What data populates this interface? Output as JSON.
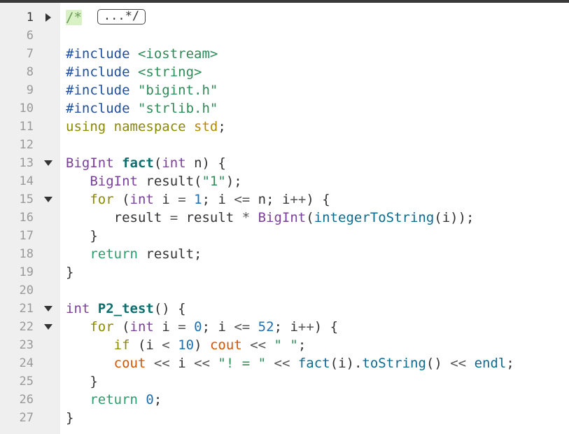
{
  "editor": {
    "lines": [
      {
        "num": "1",
        "fold": "right",
        "tokens": [
          {
            "t": "/*",
            "c": "comment-open"
          },
          {
            "t": "...*/",
            "c": "fold-box"
          }
        ]
      },
      {
        "num": "6",
        "fold": "",
        "tokens": []
      },
      {
        "num": "7",
        "fold": "",
        "tokens": [
          {
            "t": "#include ",
            "c": "pre"
          },
          {
            "t": "<iostream>",
            "c": "inc"
          }
        ]
      },
      {
        "num": "8",
        "fold": "",
        "tokens": [
          {
            "t": "#include ",
            "c": "pre"
          },
          {
            "t": "<string>",
            "c": "inc"
          }
        ]
      },
      {
        "num": "9",
        "fold": "",
        "tokens": [
          {
            "t": "#include ",
            "c": "pre"
          },
          {
            "t": "\"bigint.h\"",
            "c": "str"
          }
        ]
      },
      {
        "num": "10",
        "fold": "",
        "tokens": [
          {
            "t": "#include ",
            "c": "pre"
          },
          {
            "t": "\"strlib.h\"",
            "c": "str"
          }
        ]
      },
      {
        "num": "11",
        "fold": "",
        "tokens": [
          {
            "t": "using namespace",
            "c": "kw"
          },
          {
            "t": " ",
            "c": ""
          },
          {
            "t": "std",
            "c": "kw2"
          },
          {
            "t": ";",
            "c": ""
          }
        ]
      },
      {
        "num": "12",
        "fold": "",
        "tokens": []
      },
      {
        "num": "13",
        "fold": "down",
        "tokens": [
          {
            "t": "BigInt",
            "c": "cls"
          },
          {
            "t": " ",
            "c": ""
          },
          {
            "t": "fact",
            "c": "fn"
          },
          {
            "t": "(",
            "c": ""
          },
          {
            "t": "int",
            "c": "kw-type"
          },
          {
            "t": " n) {",
            "c": ""
          }
        ]
      },
      {
        "num": "14",
        "fold": "",
        "tokens": [
          {
            "t": "   ",
            "c": ""
          },
          {
            "t": "BigInt",
            "c": "cls"
          },
          {
            "t": " result(",
            "c": ""
          },
          {
            "t": "\"1\"",
            "c": "str"
          },
          {
            "t": ");",
            "c": ""
          }
        ]
      },
      {
        "num": "15",
        "fold": "down",
        "tokens": [
          {
            "t": "   ",
            "c": ""
          },
          {
            "t": "for",
            "c": "kw"
          },
          {
            "t": " (",
            "c": ""
          },
          {
            "t": "int",
            "c": "kw-type"
          },
          {
            "t": " i ",
            "c": ""
          },
          {
            "t": "=",
            "c": "op"
          },
          {
            "t": " ",
            "c": ""
          },
          {
            "t": "1",
            "c": "num"
          },
          {
            "t": "; i ",
            "c": ""
          },
          {
            "t": "<=",
            "c": "op"
          },
          {
            "t": " n; i",
            "c": ""
          },
          {
            "t": "++",
            "c": "op"
          },
          {
            "t": ") {",
            "c": ""
          }
        ]
      },
      {
        "num": "16",
        "fold": "",
        "tokens": [
          {
            "t": "      result ",
            "c": ""
          },
          {
            "t": "=",
            "c": "op"
          },
          {
            "t": " result ",
            "c": ""
          },
          {
            "t": "*",
            "c": "op"
          },
          {
            "t": " ",
            "c": ""
          },
          {
            "t": "BigInt",
            "c": "cls"
          },
          {
            "t": "(",
            "c": ""
          },
          {
            "t": "integerToString",
            "c": "call"
          },
          {
            "t": "(i));",
            "c": ""
          }
        ]
      },
      {
        "num": "17",
        "fold": "",
        "tokens": [
          {
            "t": "   }",
            "c": ""
          }
        ]
      },
      {
        "num": "18",
        "fold": "",
        "tokens": [
          {
            "t": "   ",
            "c": ""
          },
          {
            "t": "return",
            "c": "ret"
          },
          {
            "t": " result;",
            "c": ""
          }
        ]
      },
      {
        "num": "19",
        "fold": "",
        "tokens": [
          {
            "t": "}",
            "c": ""
          }
        ]
      },
      {
        "num": "20",
        "fold": "",
        "tokens": []
      },
      {
        "num": "21",
        "fold": "down",
        "tokens": [
          {
            "t": "int",
            "c": "kw-type"
          },
          {
            "t": " ",
            "c": ""
          },
          {
            "t": "P2_test",
            "c": "fn"
          },
          {
            "t": "() {",
            "c": ""
          }
        ]
      },
      {
        "num": "22",
        "fold": "down",
        "tokens": [
          {
            "t": "   ",
            "c": ""
          },
          {
            "t": "for",
            "c": "kw"
          },
          {
            "t": " (",
            "c": ""
          },
          {
            "t": "int",
            "c": "kw-type"
          },
          {
            "t": " i ",
            "c": ""
          },
          {
            "t": "=",
            "c": "op"
          },
          {
            "t": " ",
            "c": ""
          },
          {
            "t": "0",
            "c": "num"
          },
          {
            "t": "; i ",
            "c": ""
          },
          {
            "t": "<=",
            "c": "op"
          },
          {
            "t": " ",
            "c": ""
          },
          {
            "t": "52",
            "c": "num"
          },
          {
            "t": "; i",
            "c": ""
          },
          {
            "t": "++",
            "c": "op"
          },
          {
            "t": ") {",
            "c": ""
          }
        ]
      },
      {
        "num": "23",
        "fold": "",
        "tokens": [
          {
            "t": "      ",
            "c": ""
          },
          {
            "t": "if",
            "c": "kw"
          },
          {
            "t": " (i ",
            "c": ""
          },
          {
            "t": "<",
            "c": "op"
          },
          {
            "t": " ",
            "c": ""
          },
          {
            "t": "10",
            "c": "num"
          },
          {
            "t": ") ",
            "c": ""
          },
          {
            "t": "cout",
            "c": "cout"
          },
          {
            "t": " ",
            "c": ""
          },
          {
            "t": "<<",
            "c": "op"
          },
          {
            "t": " ",
            "c": ""
          },
          {
            "t": "\" \"",
            "c": "str"
          },
          {
            "t": ";",
            "c": ""
          }
        ]
      },
      {
        "num": "24",
        "fold": "",
        "tokens": [
          {
            "t": "      ",
            "c": ""
          },
          {
            "t": "cout",
            "c": "cout"
          },
          {
            "t": " ",
            "c": ""
          },
          {
            "t": "<<",
            "c": "op"
          },
          {
            "t": " i ",
            "c": ""
          },
          {
            "t": "<<",
            "c": "op"
          },
          {
            "t": " ",
            "c": ""
          },
          {
            "t": "\"! = \"",
            "c": "str"
          },
          {
            "t": " ",
            "c": ""
          },
          {
            "t": "<<",
            "c": "op"
          },
          {
            "t": " ",
            "c": ""
          },
          {
            "t": "fact",
            "c": "call"
          },
          {
            "t": "(i).",
            "c": ""
          },
          {
            "t": "toString",
            "c": "call"
          },
          {
            "t": "() ",
            "c": ""
          },
          {
            "t": "<<",
            "c": "op"
          },
          {
            "t": " ",
            "c": ""
          },
          {
            "t": "endl",
            "c": "call"
          },
          {
            "t": ";",
            "c": ""
          }
        ]
      },
      {
        "num": "25",
        "fold": "",
        "tokens": [
          {
            "t": "   }",
            "c": ""
          }
        ]
      },
      {
        "num": "26",
        "fold": "",
        "tokens": [
          {
            "t": "   ",
            "c": ""
          },
          {
            "t": "return",
            "c": "ret"
          },
          {
            "t": " ",
            "c": ""
          },
          {
            "t": "0",
            "c": "num"
          },
          {
            "t": ";",
            "c": ""
          }
        ]
      },
      {
        "num": "27",
        "fold": "",
        "tokens": [
          {
            "t": "}",
            "c": ""
          }
        ]
      }
    ],
    "active_line": "1"
  }
}
